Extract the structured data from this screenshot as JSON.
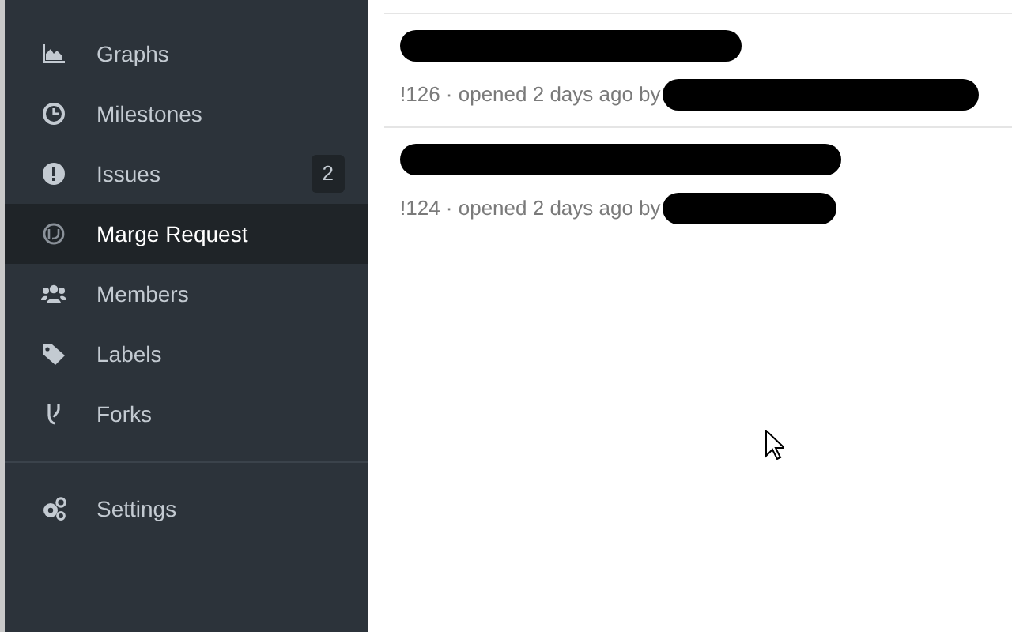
{
  "sidebar": {
    "items": [
      {
        "kind": "graphs",
        "label": "Graphs",
        "selected": false
      },
      {
        "kind": "milestones",
        "label": "Milestones",
        "selected": false
      },
      {
        "kind": "issues",
        "label": "Issues",
        "badge": "2",
        "selected": false
      },
      {
        "kind": "merge",
        "label": "Marge Request",
        "selected": true
      },
      {
        "kind": "members",
        "label": "Members",
        "selected": false
      },
      {
        "kind": "labels",
        "label": "Labels",
        "selected": false
      },
      {
        "kind": "forks",
        "label": "Forks",
        "selected": false
      }
    ],
    "footer_items": [
      {
        "kind": "settings",
        "label": "Settings",
        "selected": false
      }
    ]
  },
  "merge_requests": [
    {
      "meta": "!126 · opened 2 days ago by",
      "redacted": true
    },
    {
      "meta": "!124 · opened 2 days ago by",
      "redacted": true
    }
  ]
}
